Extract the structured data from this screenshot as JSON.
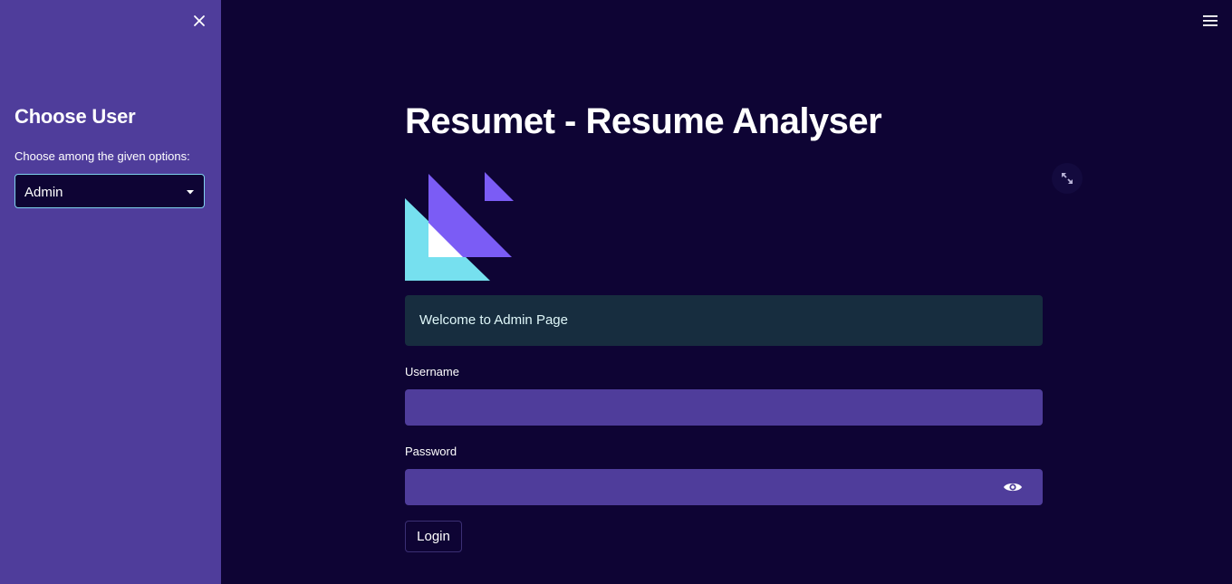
{
  "sidebar": {
    "title": "Choose User",
    "select_label": "Choose among the given options:",
    "select_value": "Admin"
  },
  "main": {
    "title": "Resumet - Resume Analyser",
    "info_message": "Welcome to Admin Page",
    "username_label": "Username",
    "username_value": "",
    "password_label": "Password",
    "password_value": "",
    "login_label": "Login"
  },
  "icons": {
    "close": "close-icon",
    "menu": "hamburger-menu-icon",
    "select_caret": "caret-down-icon",
    "fullscreen": "fullscreen-expand-icon",
    "password_toggle": "eye-icon",
    "logo": "streamlit-style-logo"
  },
  "colors": {
    "background": "#0e0434",
    "sidebar": "#4f3d9b",
    "input": "#4f3d9b",
    "info_box": "#172d3f",
    "logo_cyan": "#76e0ef",
    "logo_purple": "#7b5cf5",
    "select_border": "#7fd1ee"
  }
}
